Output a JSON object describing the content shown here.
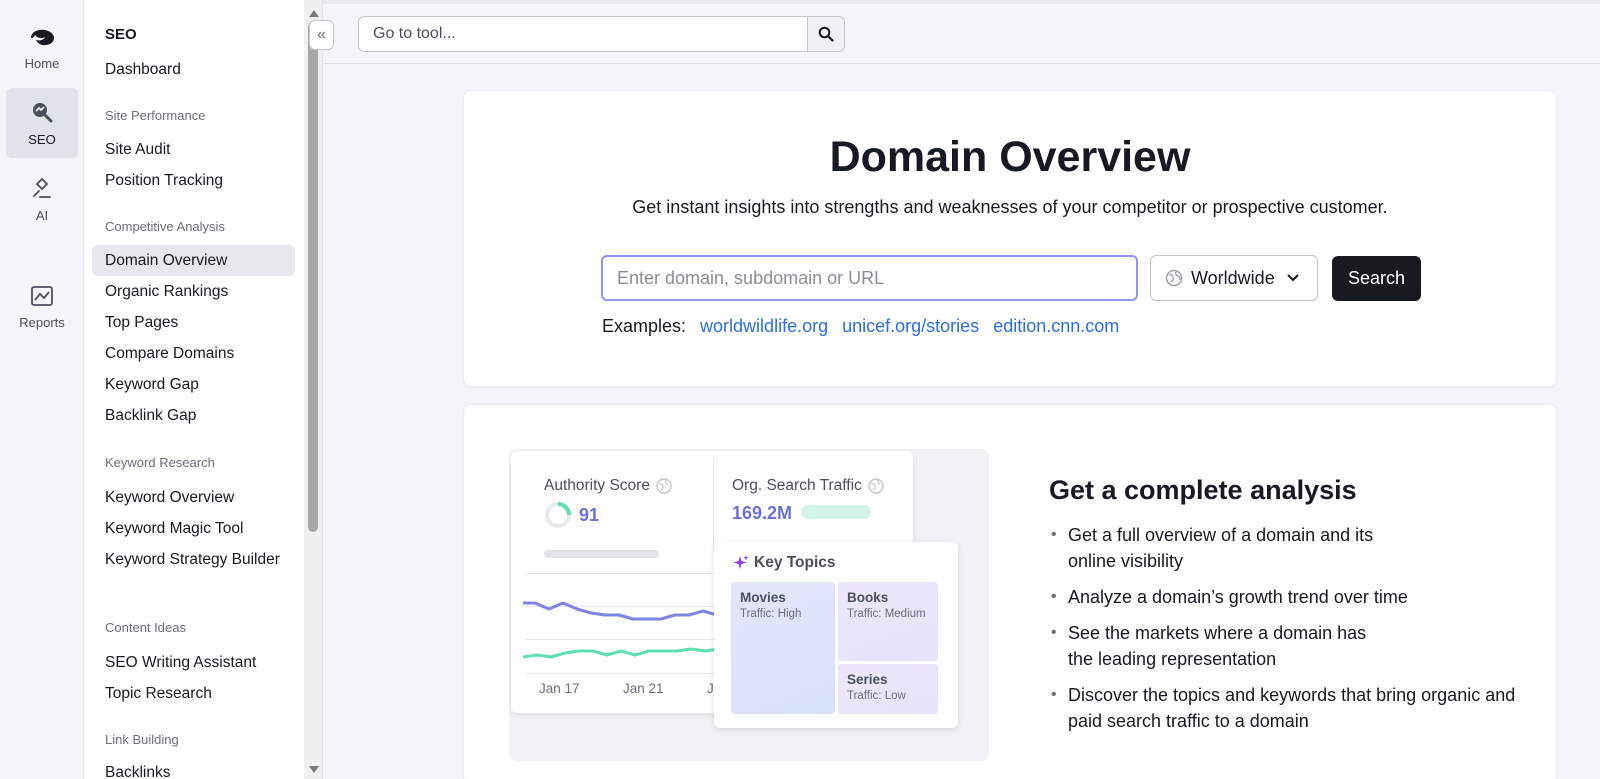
{
  "rail": {
    "items": [
      {
        "label": "Home",
        "icon": "semrush-logo-icon"
      },
      {
        "label": "SEO",
        "icon": "seo-magnifier-icon",
        "active": true
      },
      {
        "label": "AI",
        "icon": "ai-sparkle-icon"
      },
      {
        "label": "Reports",
        "icon": "reports-chart-icon"
      }
    ]
  },
  "nav": {
    "title": "SEO",
    "dashboard": "Dashboard",
    "sections": [
      {
        "label": "Site Performance",
        "links": [
          "Site Audit",
          "Position Tracking"
        ]
      },
      {
        "label": "Competitive Analysis",
        "links": [
          "Domain Overview",
          "Organic Rankings",
          "Top Pages",
          "Compare Domains",
          "Keyword Gap",
          "Backlink Gap"
        ]
      },
      {
        "label": "Keyword Research",
        "links": [
          "Keyword Overview",
          "Keyword Magic Tool",
          "Keyword Strategy Builder"
        ]
      },
      {
        "label": "Content Ideas",
        "links": [
          "SEO Writing Assistant",
          "Topic Research"
        ]
      },
      {
        "label": "Link Building",
        "links": [
          "Backlinks"
        ]
      }
    ],
    "active": "Domain Overview"
  },
  "topbar": {
    "goto_placeholder": "Go to tool..."
  },
  "hero": {
    "title": "Domain Overview",
    "subtitle": "Get instant insights into strengths and weaknesses of your competitor or prospective customer.",
    "input_placeholder": "Enter domain, subdomain or URL",
    "region": "Worldwide",
    "search_label": "Search",
    "examples_label": "Examples:",
    "examples": [
      "worldwildlife.org",
      "unicef.org/stories",
      "edition.cnn.com"
    ]
  },
  "illustration": {
    "authority_label": "Authority Score",
    "authority_value": "91",
    "traffic_label": "Org. Search Traffic",
    "traffic_value": "169.2M",
    "x_ticks": [
      "Jan 17",
      "Jan 21",
      "J"
    ],
    "key_topics_title": "Key Topics",
    "topics": [
      {
        "name": "Movies",
        "traffic": "Traffic: High"
      },
      {
        "name": "Books",
        "traffic": "Traffic: Medium"
      },
      {
        "name": "Series",
        "traffic": "Traffic: Low"
      }
    ],
    "series_colors": {
      "blue": "#7c85e0",
      "green": "#5ee0b0"
    }
  },
  "analysis": {
    "title": "Get a complete analysis",
    "bullets": [
      "Get a full overview of a domain and its online visibility",
      "Analyze a domain’s growth trend over time",
      "See the markets where a domain has the leading representation",
      "Discover the topics and keywords that bring organic and paid search traffic to a domain"
    ]
  }
}
